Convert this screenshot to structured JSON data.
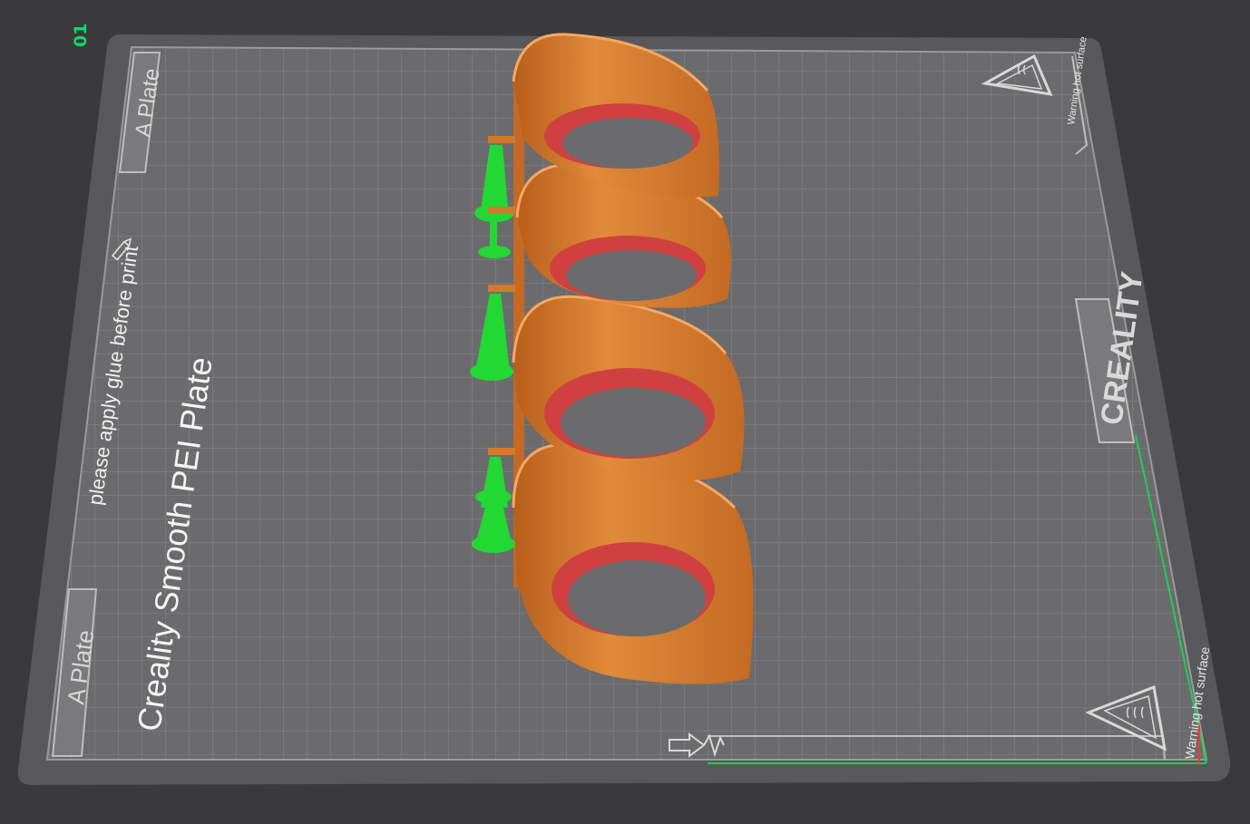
{
  "plate": {
    "index": "01",
    "name_top": "A Plate",
    "name_bottom": "A Plate",
    "surface_title": "Creality Smooth PEI Plate",
    "note": "please apply glue before print",
    "brand": "CREALITY",
    "warning_top": "Warning hot surface",
    "warning_bottom": "Warning hot surface"
  },
  "model": {
    "color": "#d4792c",
    "infill_color": "#d04040",
    "support_color": "#22d833",
    "rings": 4
  },
  "colors": {
    "bed": "#5e5e60",
    "grid": "#8a8a8c",
    "axis_x": "#22cc55",
    "axis_y": "#ff3333"
  }
}
